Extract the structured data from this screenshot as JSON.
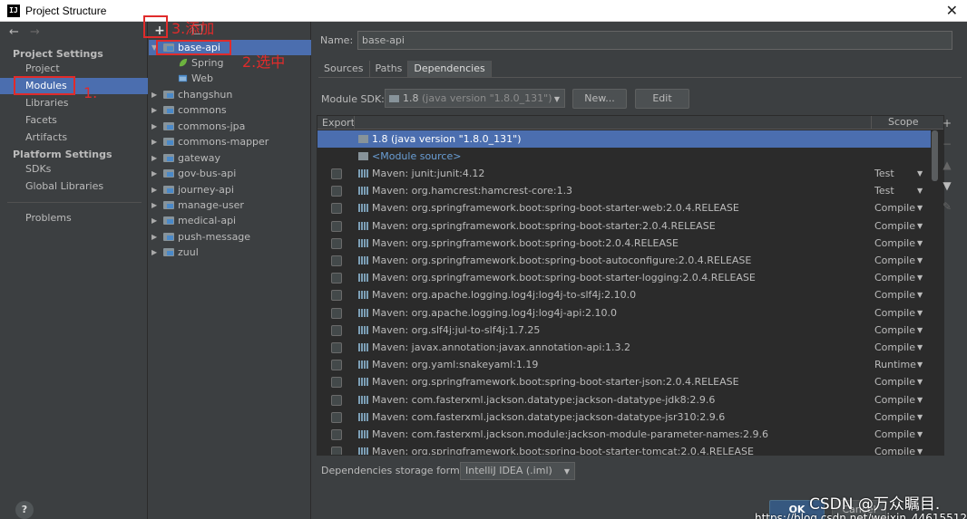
{
  "window": {
    "title": "Project Structure",
    "app_icon": "IJ",
    "close_glyph": "✕"
  },
  "nav": {
    "back": "←",
    "forward": "→"
  },
  "left": {
    "project_settings_header": "Project Settings",
    "project_items": [
      "Project",
      "Modules",
      "Libraries",
      "Facets",
      "Artifacts"
    ],
    "platform_settings_header": "Platform Settings",
    "platform_items": [
      "SDKs",
      "Global Libraries"
    ],
    "problems": "Problems",
    "help": "?"
  },
  "middle": {
    "add_glyph": "+",
    "modules": [
      {
        "name": "base-api",
        "expanded": true,
        "selected": true,
        "children": [
          "Spring",
          "Web"
        ]
      },
      {
        "name": "changshun"
      },
      {
        "name": "commons"
      },
      {
        "name": "commons-jpa"
      },
      {
        "name": "commons-mapper"
      },
      {
        "name": "gateway"
      },
      {
        "name": "gov-bus-api"
      },
      {
        "name": "journey-api"
      },
      {
        "name": "manage-user"
      },
      {
        "name": "medical-api"
      },
      {
        "name": "push-message"
      },
      {
        "name": "zuul"
      }
    ]
  },
  "right": {
    "name_label": "Name:",
    "name_value": "base-api",
    "tabs": [
      "Sources",
      "Paths",
      "Dependencies"
    ],
    "active_tab": "Dependencies",
    "sdk_label": "Module SDK:",
    "sdk_value": "1.8",
    "sdk_detail": "(java version \"1.8.0_131\")",
    "new_button": "New...",
    "edit_button": "Edit",
    "table_headers": {
      "export": "Export",
      "scope": "Scope"
    },
    "jdk_row": "1.8 (java version \"1.8.0_131\")",
    "module_source_row": "<Module source>",
    "dependencies": [
      {
        "name": "Maven: junit:junit:4.12",
        "scope": "Test"
      },
      {
        "name": "Maven: org.hamcrest:hamcrest-core:1.3",
        "scope": "Test"
      },
      {
        "name": "Maven: org.springframework.boot:spring-boot-starter-web:2.0.4.RELEASE",
        "scope": "Compile"
      },
      {
        "name": "Maven: org.springframework.boot:spring-boot-starter:2.0.4.RELEASE",
        "scope": "Compile"
      },
      {
        "name": "Maven: org.springframework.boot:spring-boot:2.0.4.RELEASE",
        "scope": "Compile"
      },
      {
        "name": "Maven: org.springframework.boot:spring-boot-autoconfigure:2.0.4.RELEASE",
        "scope": "Compile"
      },
      {
        "name": "Maven: org.springframework.boot:spring-boot-starter-logging:2.0.4.RELEASE",
        "scope": "Compile"
      },
      {
        "name": "Maven: org.apache.logging.log4j:log4j-to-slf4j:2.10.0",
        "scope": "Compile"
      },
      {
        "name": "Maven: org.apache.logging.log4j:log4j-api:2.10.0",
        "scope": "Compile"
      },
      {
        "name": "Maven: org.slf4j:jul-to-slf4j:1.7.25",
        "scope": "Compile"
      },
      {
        "name": "Maven: javax.annotation:javax.annotation-api:1.3.2",
        "scope": "Compile"
      },
      {
        "name": "Maven: org.yaml:snakeyaml:1.19",
        "scope": "Runtime"
      },
      {
        "name": "Maven: org.springframework.boot:spring-boot-starter-json:2.0.4.RELEASE",
        "scope": "Compile"
      },
      {
        "name": "Maven: com.fasterxml.jackson.datatype:jackson-datatype-jdk8:2.9.6",
        "scope": "Compile"
      },
      {
        "name": "Maven: com.fasterxml.jackson.datatype:jackson-datatype-jsr310:2.9.6",
        "scope": "Compile"
      },
      {
        "name": "Maven: com.fasterxml.jackson.module:jackson-module-parameter-names:2.9.6",
        "scope": "Compile"
      },
      {
        "name": "Maven: org.springframework.boot:spring-boot-starter-tomcat:2.0.4.RELEASE",
        "scope": "Compile"
      }
    ],
    "side_tools": [
      "+",
      "−",
      "▲",
      "▼",
      "✎"
    ],
    "storage_label": "Dependencies storage format:",
    "storage_value": "IntelliJ IDEA (.iml)",
    "ok": "OK",
    "cancel": "Cancel"
  },
  "annotations": {
    "step1": "1.",
    "step2": "2.选中",
    "step3": "3.添加"
  },
  "watermark": {
    "text": "CSDN @万众瞩目.",
    "url": "https://blog.csdn.net/weixin_44615512"
  },
  "colors": {
    "selection": "#4b6eaf",
    "annotation": "#e02b2b",
    "panel": "#3c3f41",
    "table_bg": "#2b2b2b"
  }
}
